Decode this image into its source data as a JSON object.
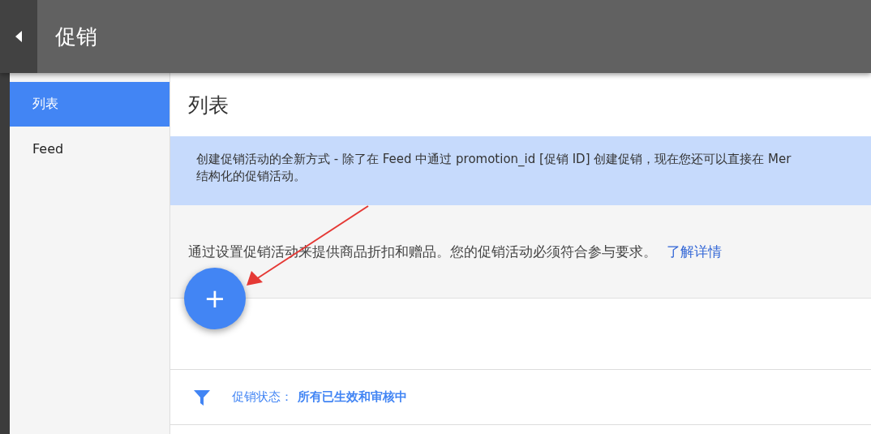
{
  "header": {
    "title": "促销"
  },
  "sidebar": {
    "items": [
      {
        "label": "列表",
        "selected": true
      },
      {
        "label": "Feed",
        "selected": false
      }
    ]
  },
  "main": {
    "title": "列表",
    "banner": {
      "lines": [
        "创建促销活动的全新方式 - 除了在 Feed 中通过 promotion_id [促销 ID] 创建促销，现在您还可以直接在 Mer",
        "结构化的促销活动。"
      ]
    },
    "intro": {
      "text": "通过设置促销活动来提供商品折扣和赠品。您的促销活动必须符合参与要求。",
      "link": "了解详情"
    },
    "add_button": {
      "label": "+"
    },
    "filter": {
      "label": "促销状态：",
      "value": "所有已生效和审核中"
    }
  }
}
